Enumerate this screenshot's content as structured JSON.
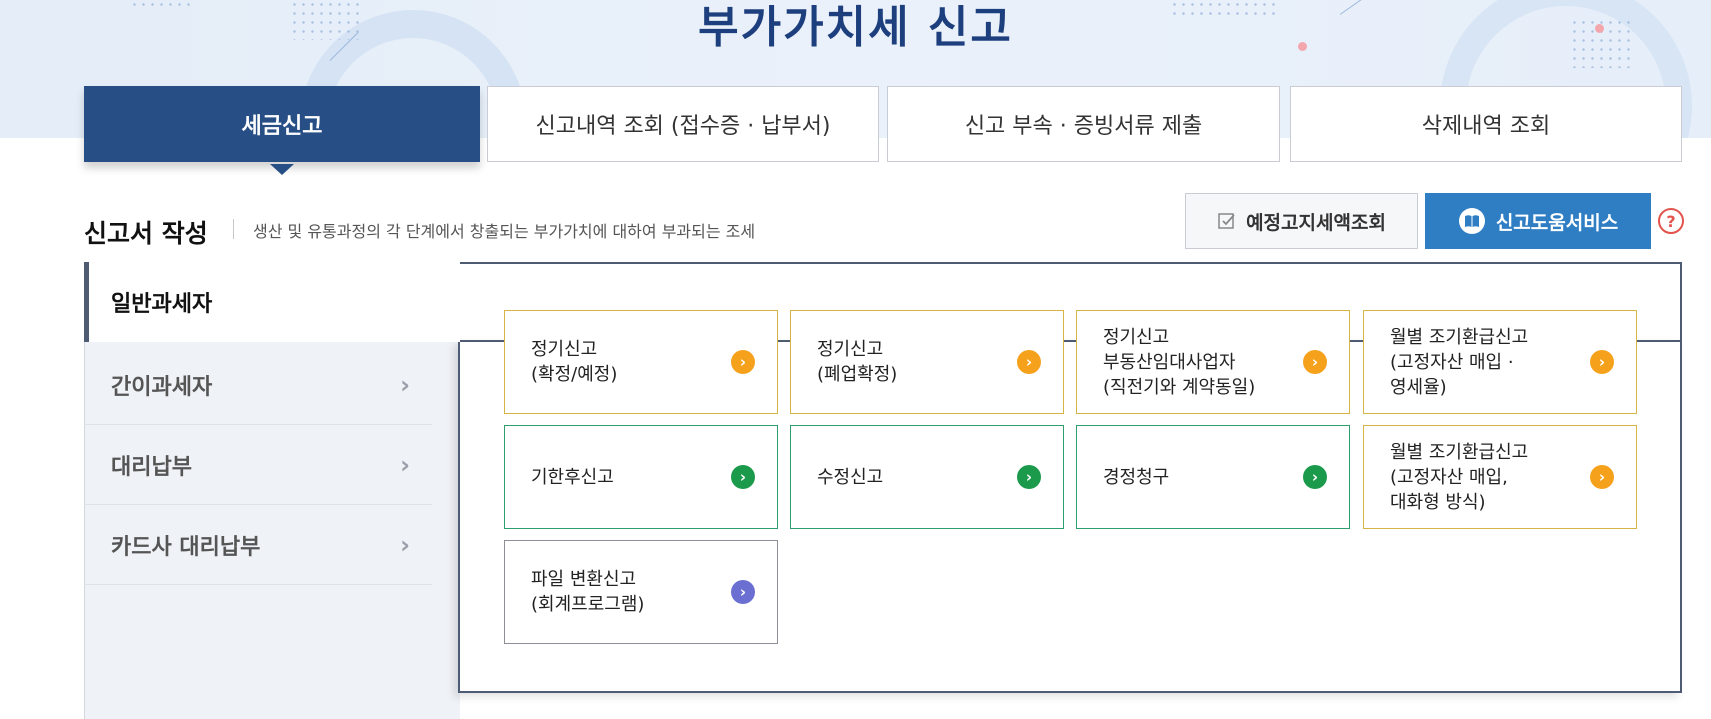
{
  "page": {
    "title": "부가가치세 신고"
  },
  "tabs": [
    {
      "label": "세금신고",
      "active": true
    },
    {
      "label": "신고내역 조회 (접수증 · 납부서)",
      "active": false
    },
    {
      "label": "신고 부속 · 증빙서류 제출",
      "active": false
    },
    {
      "label": "삭제내역 조회",
      "active": false
    }
  ],
  "section": {
    "title": "신고서 작성",
    "description": "생산 및 유통과정의 각 단계에서 창출되는 부가가치에 대하여 부과되는 조세"
  },
  "actions": {
    "estimate_label": "예정고지세액조회",
    "help_label": "신고도움서비스",
    "question_mark": "?"
  },
  "sidebar": {
    "active_label": "일반과세자",
    "items": [
      {
        "label": "간이과세자",
        "chevron": "›"
      },
      {
        "label": "대리납부",
        "chevron": "›"
      },
      {
        "label": "카드사 대리납부",
        "chevron": "›"
      }
    ]
  },
  "cards": [
    {
      "label": "정기신고\n(확정/예정)",
      "color": "#f5a11c",
      "arrow": "›"
    },
    {
      "label": "정기신고\n(폐업확정)",
      "color": "#f5a11c",
      "arrow": "›"
    },
    {
      "label": "정기신고\n부동산임대사업자\n(직전기와 계약동일)",
      "color": "#f5a11c",
      "arrow": "›"
    },
    {
      "label": "월별 조기환급신고\n(고정자산 매입 ·\n영세율)",
      "color": "#f5a11c",
      "arrow": "›"
    },
    {
      "label": "기한후신고",
      "color": "#1c9a4b",
      "arrow": "›"
    },
    {
      "label": "수정신고",
      "color": "#1c9a4b",
      "arrow": "›"
    },
    {
      "label": "경정청구",
      "color": "#1c9a4b",
      "arrow": "›"
    },
    {
      "label": "월별 조기환급신고\n(고정자산 매입,\n대화형 방식)",
      "color": "#f5a11c",
      "arrow": "›"
    },
    {
      "label": "파일 변환신고\n(회계프로그램)",
      "color": "#6b6fd1",
      "arrow": "›"
    }
  ]
}
